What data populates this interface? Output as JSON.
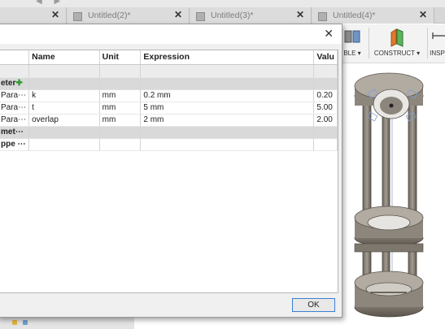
{
  "tabs": [
    {
      "label": ""
    },
    {
      "label": "Untitled(2)*"
    },
    {
      "label": "Untitled(3)*"
    },
    {
      "label": "Untitled(4)*"
    }
  ],
  "toolbar": {
    "tools_partial_label": "BLE ▾",
    "construct_label": "CONSTRUCT ▾",
    "inspect_partial_label": "INSP"
  },
  "dialog": {
    "close_glyph": "✕",
    "ok_label": "OK",
    "columns": [
      "Name",
      "Unit",
      "Expression",
      "Valu"
    ],
    "group_model_label": "eter",
    "group_model_plus": "✚",
    "rows": [
      {
        "source": "Para⋯",
        "name": "k",
        "unit": "mm",
        "expression": "0.2 mm",
        "value": "0.20"
      },
      {
        "source": "Para⋯",
        "name": "t",
        "unit": "mm",
        "expression": "5 mm",
        "value": "5.00"
      },
      {
        "source": "Para⋯",
        "name": "overlap",
        "unit": "mm",
        "expression": "2 mm",
        "value": "2.00"
      }
    ],
    "group_model_params_label": "met⋯",
    "last_row_label": "ppe  ⋯"
  },
  "colors": {
    "accent": "#3c7fd1",
    "plus_green": "#2e9a2e",
    "part_gray": "#7b746a"
  }
}
